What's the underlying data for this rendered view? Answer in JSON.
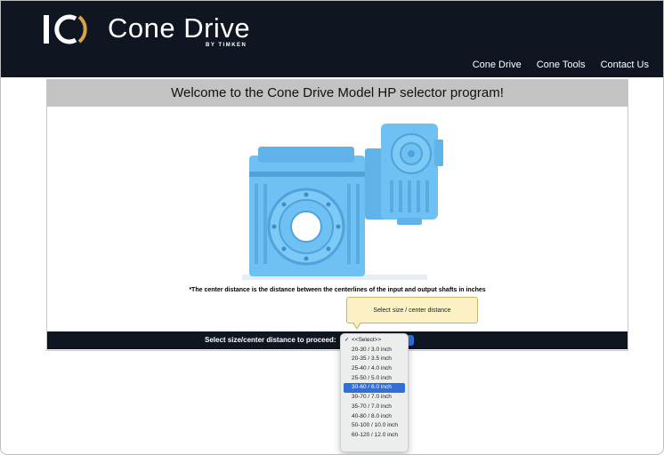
{
  "header": {
    "brand_name": "Cone Drive",
    "brand_sub": "BY TIMKEN",
    "nav": [
      "Cone Drive",
      "Cone Tools",
      "Contact Us"
    ]
  },
  "colors": {
    "header_bg": "#0f1621",
    "title_bar": "#c3c3c3",
    "gear_blue": "#6ec1f2",
    "logo_accent": "#d6a24a",
    "selection": "#2f6fd6",
    "tooltip_bg": "#fbf1c4"
  },
  "main": {
    "title": "Welcome to the Cone Drive Model HP selector program!",
    "caption": "*The center distance is the distance between the centerlines of the input and output shafts in inches",
    "tooltip": "Select size / center distance",
    "select_label": "Select size/center distance to proceed:"
  },
  "dropdown": {
    "options": [
      "<<Select>>",
      "20-30 / 3.0 inch",
      "20-35 / 3.5 inch",
      "25-40 / 4.0 inch",
      "25-50 / 5.0 inch",
      "30-60 / 6.0 inch",
      "30-70 / 7.0 inch",
      "35-70 / 7.0 inch",
      "40-80 / 8.0 inch",
      "50-100 / 10.0 inch",
      "60-120 / 12.0 inch"
    ],
    "checked_label": "<<Select>>",
    "highlighted": "30-60 / 6.0 inch",
    "check_glyph": "✓"
  }
}
